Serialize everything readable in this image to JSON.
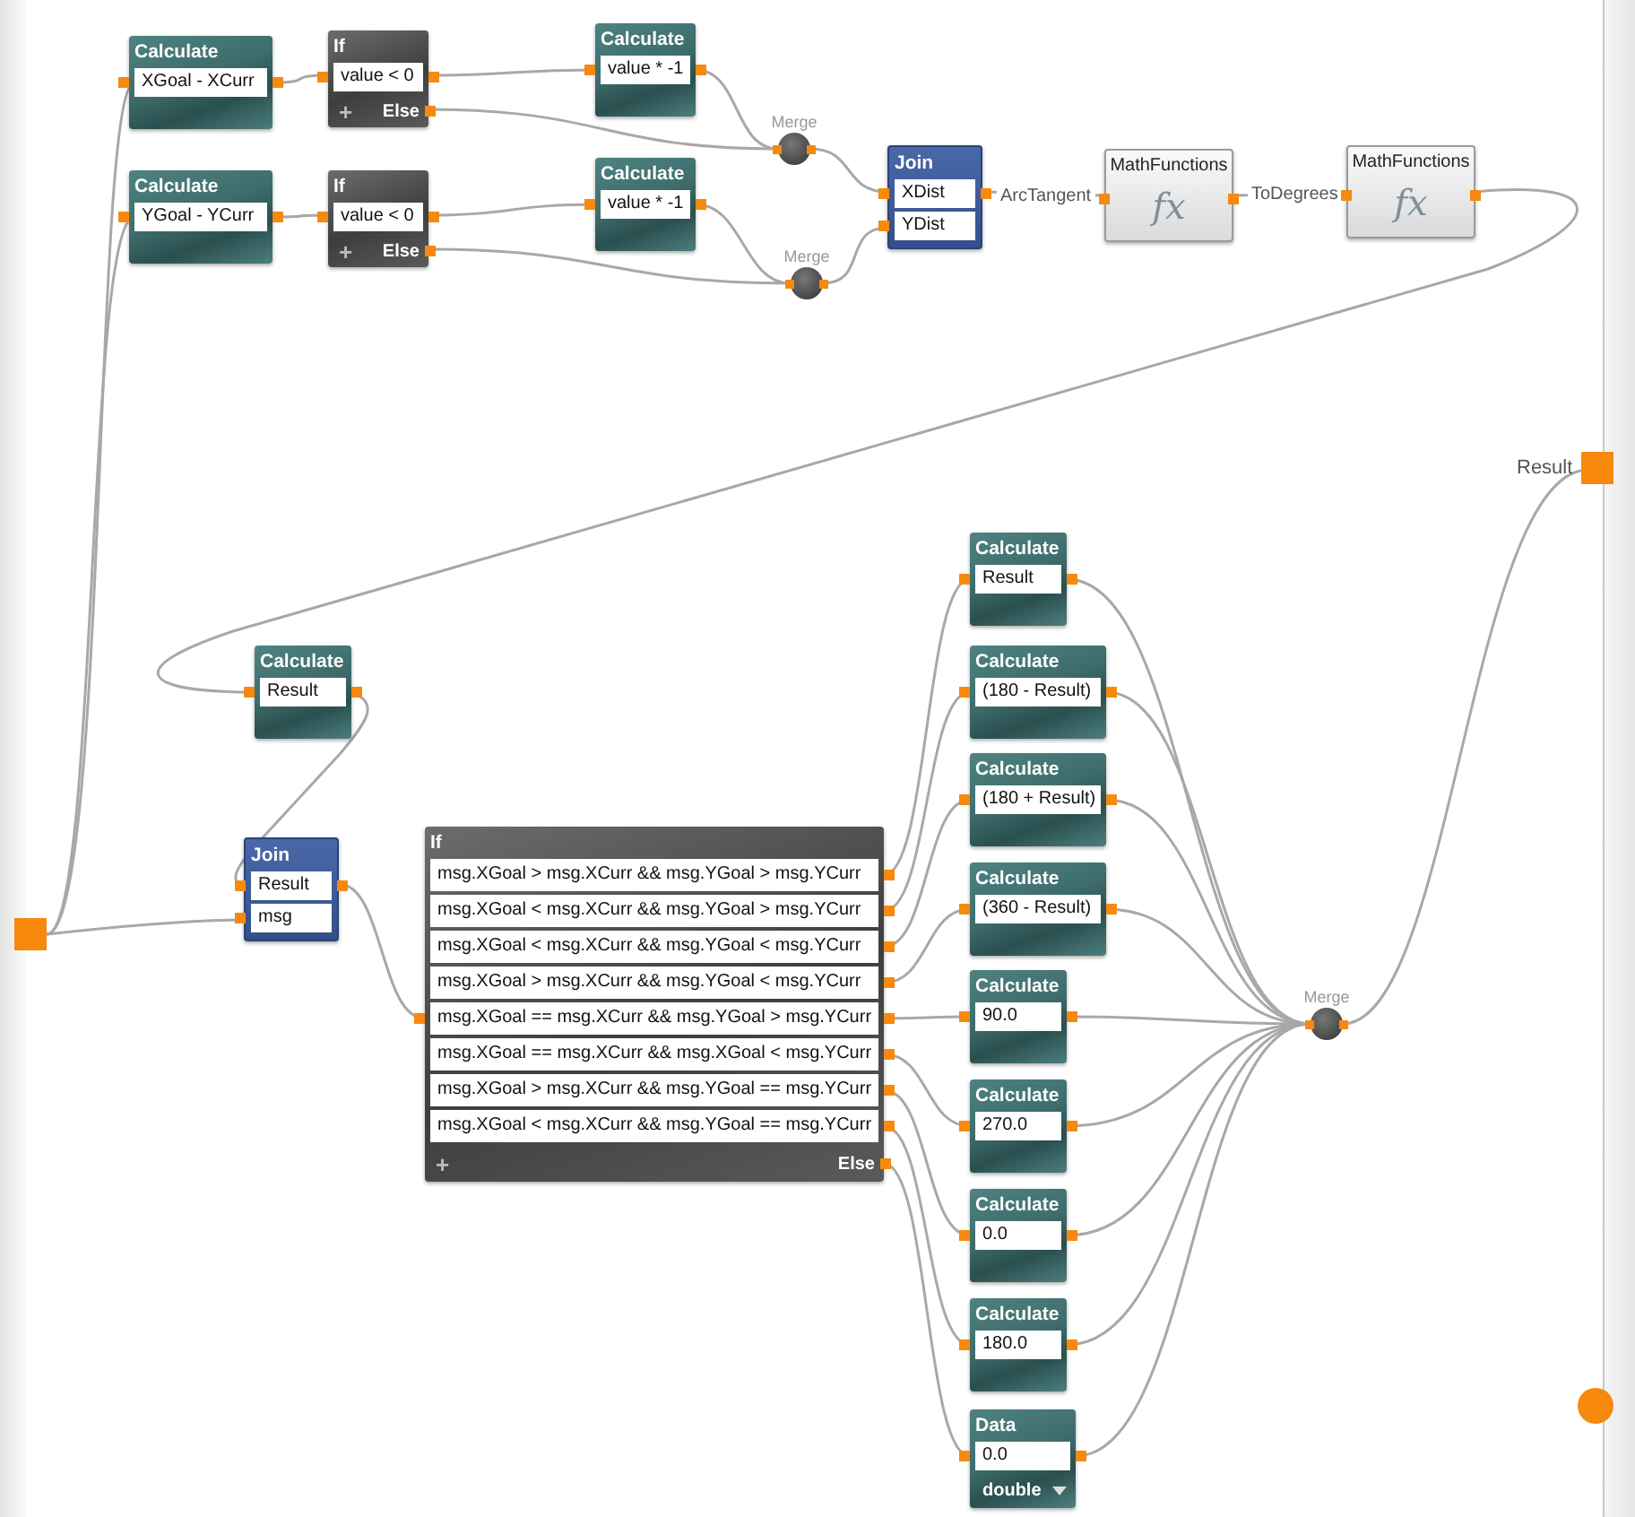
{
  "nodes": [
    {
      "kind": "calculate",
      "title": "Calculate",
      "fields": [
        "XGoal - XCurr"
      ]
    },
    {
      "kind": "if",
      "title": "If",
      "conditions": [
        "value < 0"
      ],
      "add": "+",
      "else": "Else"
    },
    {
      "kind": "calculate",
      "title": "Calculate",
      "fields": [
        "value * -1"
      ]
    },
    {
      "kind": "merge",
      "title": "Merge"
    },
    {
      "kind": "calculate",
      "title": "Calculate",
      "fields": [
        "YGoal - YCurr"
      ]
    },
    {
      "kind": "if",
      "title": "If",
      "conditions": [
        "value < 0"
      ],
      "add": "+",
      "else": "Else"
    },
    {
      "kind": "calculate",
      "title": "Calculate",
      "fields": [
        "value * -1"
      ]
    },
    {
      "kind": "merge",
      "title": "Merge"
    },
    {
      "kind": "join",
      "title": "Join",
      "fields": [
        "XDist",
        "YDist"
      ]
    },
    {
      "kind": "function",
      "title": "MathFunctions",
      "symbol": "fx"
    },
    {
      "kind": "function",
      "title": "MathFunctions",
      "symbol": "fx"
    },
    {
      "kind": "calculate",
      "title": "Calculate",
      "fields": [
        "Result"
      ]
    },
    {
      "kind": "join",
      "title": "Join",
      "fields": [
        "Result",
        "msg"
      ]
    },
    {
      "kind": "if",
      "title": "If",
      "conditions": [
        "msg.XGoal > msg.XCurr && msg.YGoal > msg.YCurr",
        "msg.XGoal < msg.XCurr && msg.YGoal > msg.YCurr",
        "msg.XGoal < msg.XCurr && msg.YGoal < msg.YCurr",
        "msg.XGoal > msg.XCurr && msg.YGoal < msg.YCurr",
        "msg.XGoal == msg.XCurr && msg.YGoal > msg.YCurr",
        "msg.XGoal == msg.XCurr && msg.XGoal < msg.YCurr",
        "msg.XGoal > msg.XCurr && msg.YGoal == msg.YCurr",
        "msg.XGoal < msg.XCurr && msg.YGoal == msg.YCurr"
      ],
      "add": "+",
      "else": "Else"
    },
    {
      "kind": "calculate",
      "title": "Calculate",
      "fields": [
        "Result"
      ]
    },
    {
      "kind": "calculate",
      "title": "Calculate",
      "fields": [
        "(180 - Result)"
      ]
    },
    {
      "kind": "calculate",
      "title": "Calculate",
      "fields": [
        "(180 + Result)"
      ]
    },
    {
      "kind": "calculate",
      "title": "Calculate",
      "fields": [
        "(360 - Result)"
      ]
    },
    {
      "kind": "calculate",
      "title": "Calculate",
      "fields": [
        "90.0"
      ]
    },
    {
      "kind": "calculate",
      "title": "Calculate",
      "fields": [
        "270.0"
      ]
    },
    {
      "kind": "calculate",
      "title": "Calculate",
      "fields": [
        "0.0"
      ]
    },
    {
      "kind": "calculate",
      "title": "Calculate",
      "fields": [
        "180.0"
      ]
    },
    {
      "kind": "data",
      "title": "Data",
      "fields": [
        "0.0"
      ],
      "type": "double"
    },
    {
      "kind": "merge",
      "title": "Merge"
    }
  ],
  "wire_labels": [
    "ArcTangent",
    "ToDegrees"
  ],
  "output": {
    "label": "Result"
  }
}
